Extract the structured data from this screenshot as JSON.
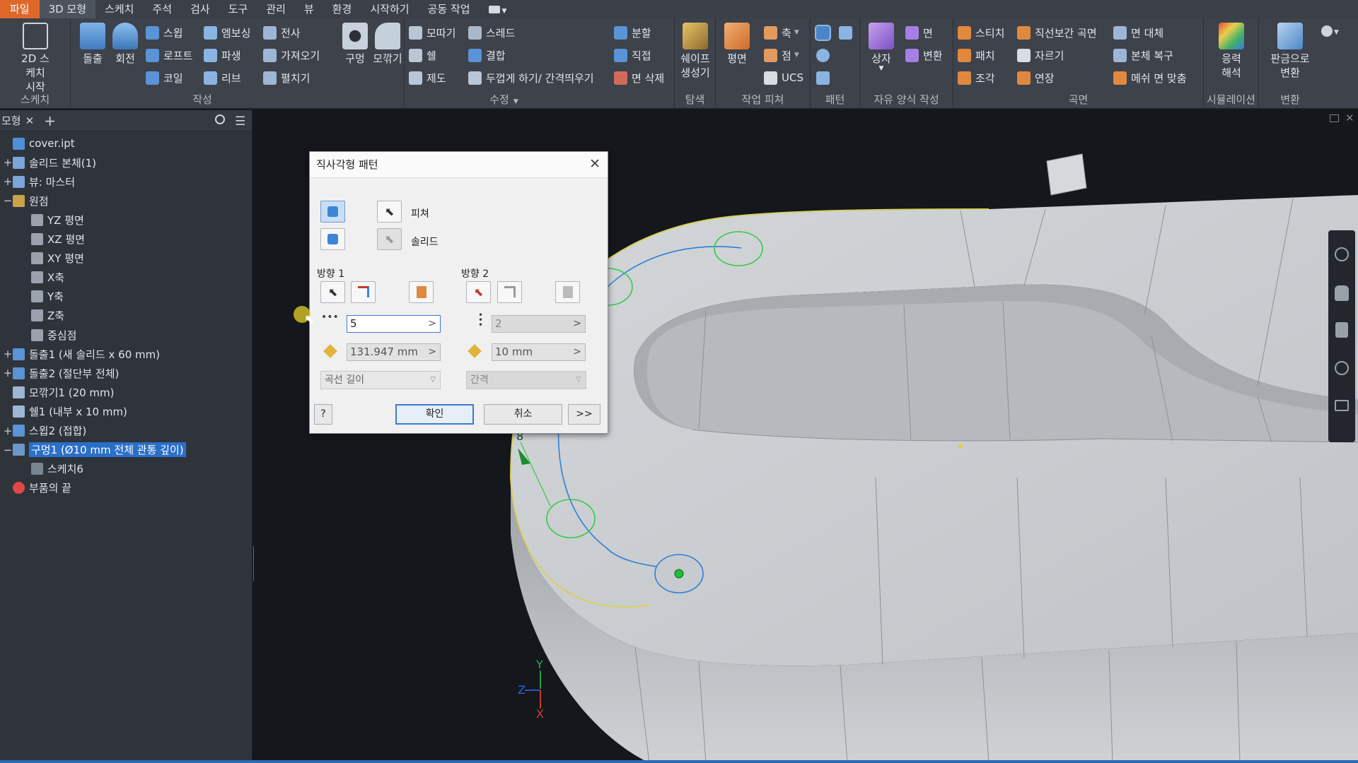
{
  "menu": [
    "파일",
    "3D 모형",
    "스케치",
    "주석",
    "검사",
    "도구",
    "관리",
    "뷰",
    "환경",
    "시작하기",
    "공동 작업"
  ],
  "ribbon": {
    "sketch": {
      "big_label": "2D 스케치\n시작",
      "group": "스케치"
    },
    "create": {
      "extrude": "돌출",
      "revolve": "회전",
      "sweep": "스윕",
      "loft": "로프트",
      "coil": "코일",
      "emboss": "엠보싱",
      "derive": "파생",
      "rib": "리브",
      "decal": "전사",
      "import": "가져오기",
      "unwrap": "펼치기",
      "group": "작성"
    },
    "modify": {
      "hole": "구멍",
      "fillet": "모깎기",
      "chamfer": "모따기",
      "shell": "쉘",
      "draft": "제도",
      "thread": "스레드",
      "combine": "결합",
      "thicken": "두껍게 하기/ 간격띄우기",
      "split": "분할",
      "direct": "직접",
      "delete_face": "면 삭제",
      "group": "수정"
    },
    "explore": {
      "shape": "쉐이프\n생성기",
      "group": "탐색"
    },
    "work": {
      "plane": "평면",
      "axis": "축",
      "point": "점",
      "ucs": "UCS",
      "group": "작업 피쳐"
    },
    "pattern": {
      "group": "패턴"
    },
    "freeform": {
      "box": "상자",
      "face": "면",
      "convert": "변환",
      "group": "자유 양식 작성"
    },
    "surface": {
      "stitch": "스티치",
      "patch": "패치",
      "sculpt": "조각",
      "ruled": "직선보간 곡면",
      "trim": "자르기",
      "extend": "연장",
      "replace": "면 대체",
      "repair": "본체 복구",
      "fit": "메쉬 면 맞춤",
      "group": "곡면"
    },
    "sim": {
      "stress": "응력\n해석",
      "group": "시뮬레이션"
    },
    "convert": {
      "sheet": "판금으로\n변환",
      "group": "변환"
    }
  },
  "browser": {
    "tab": "모형",
    "tree": [
      {
        "label": "cover.ipt",
        "exp": ""
      },
      {
        "label": "솔리드 본체(1)",
        "exp": "+"
      },
      {
        "label": "뷰: 마스터",
        "exp": "+"
      },
      {
        "label": "원점",
        "exp": "−"
      },
      {
        "label": "YZ 평면",
        "exp": ""
      },
      {
        "label": "XZ 평면",
        "exp": ""
      },
      {
        "label": "XY 평면",
        "exp": ""
      },
      {
        "label": "X축",
        "exp": ""
      },
      {
        "label": "Y축",
        "exp": ""
      },
      {
        "label": "Z축",
        "exp": ""
      },
      {
        "label": "중심점",
        "exp": ""
      },
      {
        "label": "돌출1 (새 솔리드 x 60 mm)",
        "exp": "+"
      },
      {
        "label": "돌출2 (절단부 전체)",
        "exp": "+"
      },
      {
        "label": "모깎기1 (20 mm)",
        "exp": ""
      },
      {
        "label": "쉘1 (내부 x 10 mm)",
        "exp": ""
      },
      {
        "label": "스윕2 (접합)",
        "exp": "+"
      },
      {
        "label": "구멍1 (Ø10 mm 전체 관통 깊이)",
        "exp": "−"
      },
      {
        "label": "스케치6",
        "exp": ""
      },
      {
        "label": "부품의 끝",
        "exp": ""
      }
    ]
  },
  "dialog": {
    "title": "직사각형 패턴",
    "features_label": "피쳐",
    "solids_label": "솔리드",
    "dir1_label": "방향 1",
    "dir2_label": "방향 2",
    "dir1_count": "5",
    "dir1_length": "131.947 mm",
    "dir1_method": "곡선 길이",
    "dir2_count": "2",
    "dir2_spacing": "10 mm",
    "dir2_method": "간격",
    "ok": "확인",
    "cancel": "취소",
    "more": ">>",
    "help": "?"
  },
  "viewport": {
    "preview_count": "8",
    "axes": {
      "x": "X",
      "y": "Y",
      "z": "Z"
    }
  },
  "colors": {
    "accent": "#e0672a",
    "selection": "#2a6fc9",
    "dialog_focus": "#3d7ad0"
  }
}
